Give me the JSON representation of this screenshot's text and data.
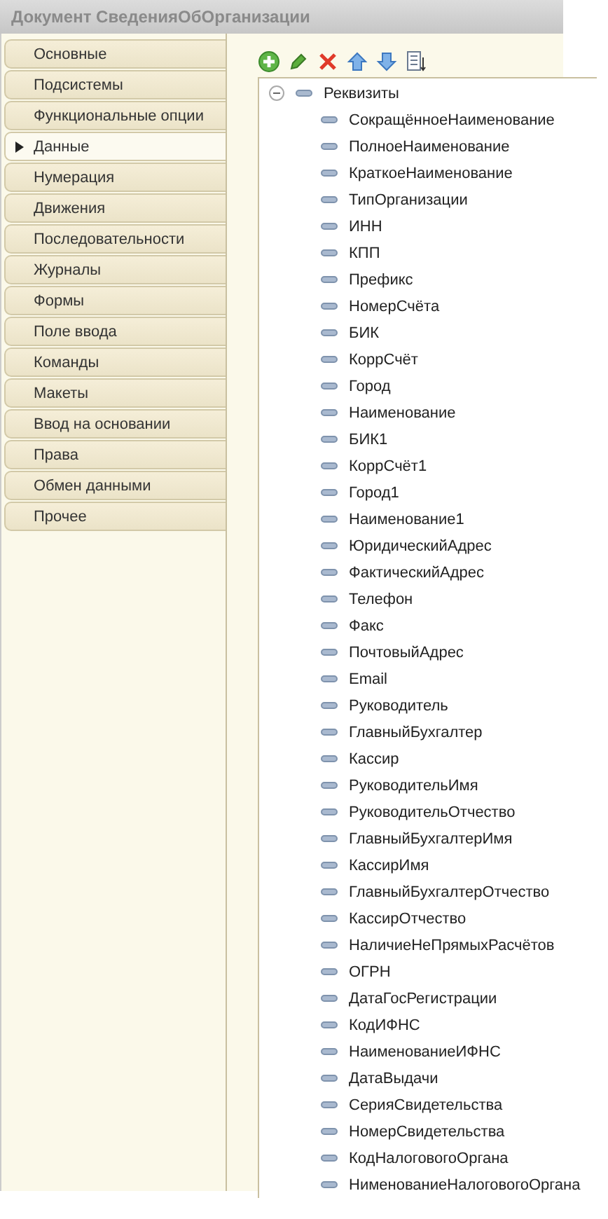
{
  "window": {
    "title": "Документ СведенияОбОрганизации"
  },
  "tabs": [
    {
      "label": "Основные",
      "selected": false
    },
    {
      "label": "Подсистемы",
      "selected": false
    },
    {
      "label": "Функциональные опции",
      "selected": false
    },
    {
      "label": "Данные",
      "selected": true
    },
    {
      "label": "Нумерация",
      "selected": false
    },
    {
      "label": "Движения",
      "selected": false
    },
    {
      "label": "Последовательности",
      "selected": false
    },
    {
      "label": "Журналы",
      "selected": false
    },
    {
      "label": "Формы",
      "selected": false
    },
    {
      "label": "Поле ввода",
      "selected": false
    },
    {
      "label": "Команды",
      "selected": false
    },
    {
      "label": "Макеты",
      "selected": false
    },
    {
      "label": "Ввод на основании",
      "selected": false
    },
    {
      "label": "Права",
      "selected": false
    },
    {
      "label": "Обмен данными",
      "selected": false
    },
    {
      "label": "Прочее",
      "selected": false
    }
  ],
  "tree": {
    "label": "Реквизиты",
    "expanded": true,
    "children": [
      {
        "label": "СокращённоеНаименование"
      },
      {
        "label": "ПолноеНаименование"
      },
      {
        "label": "КраткоеНаименование"
      },
      {
        "label": "ТипОрганизации"
      },
      {
        "label": "ИНН"
      },
      {
        "label": "КПП"
      },
      {
        "label": "Префикс"
      },
      {
        "label": "НомерСчёта"
      },
      {
        "label": "БИК"
      },
      {
        "label": "КоррСчёт"
      },
      {
        "label": "Город"
      },
      {
        "label": "Наименование"
      },
      {
        "label": "БИК1"
      },
      {
        "label": "КоррСчёт1"
      },
      {
        "label": "Город1"
      },
      {
        "label": "Наименование1"
      },
      {
        "label": "ЮридическийАдрес"
      },
      {
        "label": "ФактическийАдрес"
      },
      {
        "label": "Телефон"
      },
      {
        "label": "Факс"
      },
      {
        "label": "ПочтовыйАдрес"
      },
      {
        "label": "Email"
      },
      {
        "label": "Руководитель"
      },
      {
        "label": "ГлавныйБухгалтер"
      },
      {
        "label": "Кассир"
      },
      {
        "label": "РуководительИмя"
      },
      {
        "label": "РуководительОтчество"
      },
      {
        "label": "ГлавныйБухгалтерИмя"
      },
      {
        "label": "КассирИмя"
      },
      {
        "label": "ГлавныйБухгалтерОтчество"
      },
      {
        "label": "КассирОтчество"
      },
      {
        "label": "НаличиеНеПрямыхРасчётов"
      },
      {
        "label": "ОГРН"
      },
      {
        "label": "ДатаГосРегистрации"
      },
      {
        "label": "КодИФНС"
      },
      {
        "label": "НаименованиеИФНС"
      },
      {
        "label": "ДатаВыдачи"
      },
      {
        "label": "СерияСвидетельства"
      },
      {
        "label": "НомерСвидетельства"
      },
      {
        "label": "КодНалоговогоОргана"
      },
      {
        "label": "НименованиеНалоговогоОргана"
      }
    ]
  }
}
